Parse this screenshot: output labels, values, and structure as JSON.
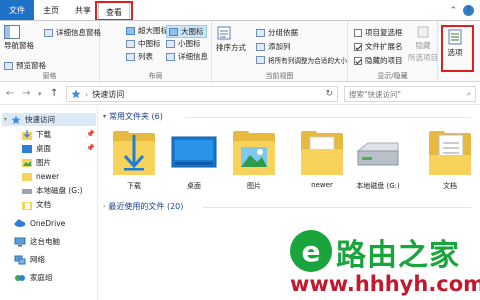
{
  "menubar": {
    "file": "文件",
    "home": "主页",
    "share": "共享",
    "view": "查看",
    "minimize_glyph": "⌃",
    "help_glyph": "?"
  },
  "ribbon": {
    "panes": {
      "nav_pane": "导航窗格",
      "preview_pane": "预览窗格",
      "details_pane": "详细信息窗格",
      "label": "窗格"
    },
    "layout": {
      "extra_large_icons": "超大图标",
      "large_icons": "大图标",
      "medium_icons": "中图标",
      "small_icons": "小图标",
      "list": "列表",
      "details": "详细信息",
      "label": "布局"
    },
    "current_view": {
      "sort_by": "排序方式",
      "group_by": "分组依据",
      "add_columns": "添加列",
      "size_all_columns": "将所有列调整为合适的大小",
      "label": "当前视图"
    },
    "show_hide": {
      "item_checkboxes": "项目复选框",
      "file_extensions": "文件扩展名",
      "hidden_items": "隐藏的项目",
      "hide_selected": "隐藏",
      "hide_selected_2": "所选项目",
      "label": "显示/隐藏"
    },
    "options": "选项"
  },
  "address": {
    "back": "←",
    "forward": "→",
    "up": "↑",
    "path": "快速访问",
    "refresh": "↻",
    "search_placeholder": "搜索\"快速访问\"",
    "search_icon": "⌕"
  },
  "sidebar": {
    "items": [
      {
        "label": "快速访问",
        "icon": "star-icon",
        "pinned": false
      },
      {
        "label": "下载",
        "icon": "download-icon",
        "pinned": true
      },
      {
        "label": "桌面",
        "icon": "desktop-icon",
        "pinned": true
      },
      {
        "label": "图片",
        "icon": "pictures-icon",
        "pinned": false
      },
      {
        "label": "newer",
        "icon": "folder-icon",
        "pinned": false
      },
      {
        "label": "本地磁盘 (G:)",
        "icon": "drive-icon",
        "pinned": false
      },
      {
        "label": "文档",
        "icon": "documents-icon",
        "pinned": false
      },
      {
        "label": "OneDrive",
        "icon": "cloud-icon",
        "pinned": false
      },
      {
        "label": "这台电脑",
        "icon": "computer-icon",
        "pinned": false
      },
      {
        "label": "网络",
        "icon": "network-icon",
        "pinned": false
      },
      {
        "label": "家庭组",
        "icon": "homegroup-icon",
        "pinned": false
      }
    ]
  },
  "main": {
    "frequent_folders": "常用文件夹 (6)",
    "recent_files": "最近使用的文件 (20)",
    "tiles": [
      {
        "label": "下载",
        "icon": "download-folder-icon"
      },
      {
        "label": "桌面",
        "icon": "desktop-folder-icon"
      },
      {
        "label": "图片",
        "icon": "pictures-folder-icon"
      },
      {
        "label": "newer",
        "icon": "folder-icon"
      },
      {
        "label": "本地磁盘 (G:)",
        "icon": "drive-icon"
      },
      {
        "label": "文档",
        "icon": "documents-folder-icon"
      }
    ]
  },
  "watermark": {
    "logo_letter": "e",
    "brand": "路由之家",
    "url": "www.hhhyh.com"
  },
  "colors": {
    "accent": "#1e73c8",
    "highlight_box": "#e02020",
    "folder": "#f7d35c",
    "watermark_green": "#19a53b",
    "watermark_red": "#c4192d"
  }
}
